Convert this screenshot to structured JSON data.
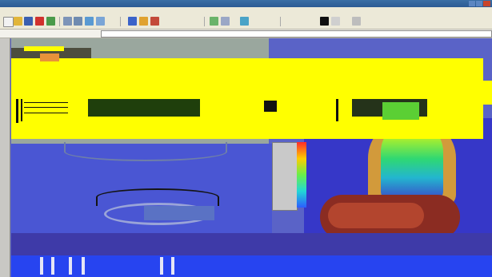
{
  "window": {
    "title": ""
  },
  "menubar": {
    "items": []
  },
  "toolbar": {
    "buttons": []
  },
  "prompt": {
    "text": "",
    "input_value": ""
  },
  "colors": {
    "title_bar": "#2b5a94",
    "chrome": "#ece9d8",
    "viewport_blue": "#3637c8",
    "artifact_yellow": "#ffff00"
  }
}
